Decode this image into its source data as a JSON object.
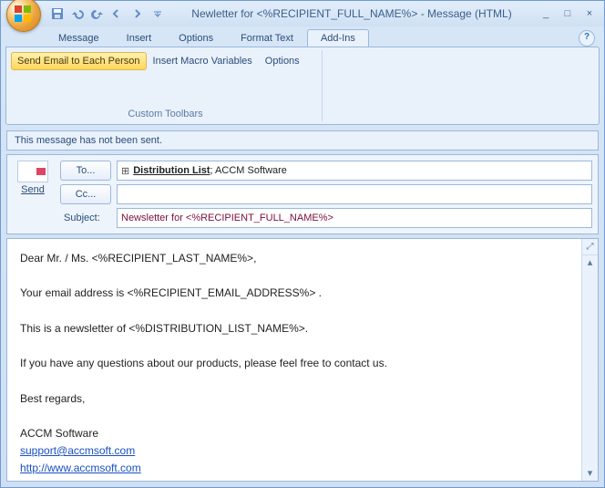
{
  "title": "Newletter for <%RECIPIENT_FULL_NAME%> - Message (HTML)",
  "ribbon": {
    "tabs": [
      "Message",
      "Insert",
      "Options",
      "Format Text",
      "Add-Ins"
    ],
    "active": 4,
    "group": {
      "label": "Custom Toolbars",
      "buttons": {
        "send_each": "Send Email to Each Person",
        "insert_macro": "Insert Macro Variables",
        "options": "Options"
      }
    }
  },
  "info": "This message has not been sent.",
  "compose": {
    "send": "Send",
    "to_btn": "To...",
    "cc_btn": "Cc...",
    "subject_label": "Subject:",
    "to_value_prefix": "Distribution List",
    "to_value_suffix": "; ACCM Software",
    "to_expand": "⊞",
    "cc_value": "",
    "subject_value": "Newsletter for <%RECIPIENT_FULL_NAME%>"
  },
  "body": {
    "l1": "Dear Mr. / Ms. <%RECIPIENT_LAST_NAME%>,",
    "l2": "Your email address is <%RECIPIENT_EMAIL_ADDRESS%> .",
    "l3": "This is a newsletter of <%DISTRIBUTION_LIST_NAME%>.",
    "l4": "If you have any questions about our products, please feel free to contact us.",
    "l5": "Best regards,",
    "l6": "ACCM Software",
    "link1": "support@accmsoft.com",
    "link2": "http://www.accmsoft.com"
  }
}
